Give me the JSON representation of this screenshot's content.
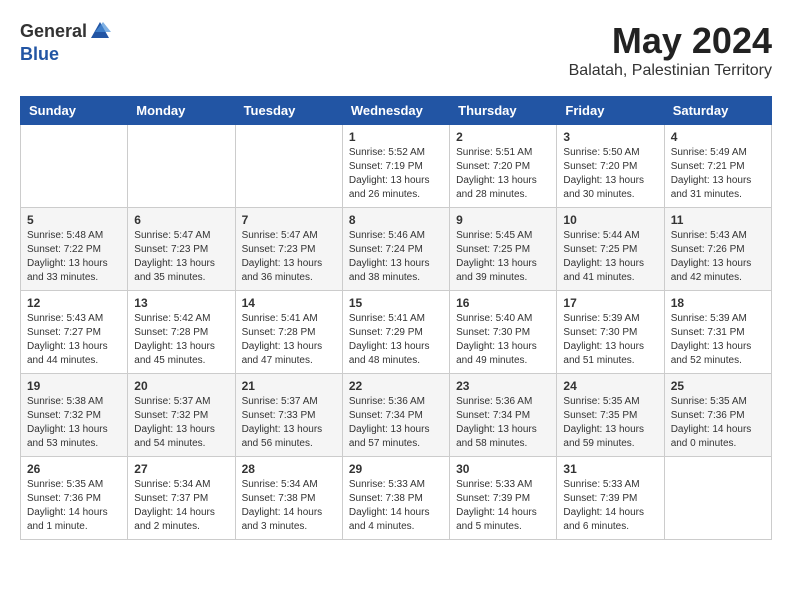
{
  "header": {
    "logo_general": "General",
    "logo_blue": "Blue",
    "month_title": "May 2024",
    "location": "Balatah, Palestinian Territory"
  },
  "weekdays": [
    "Sunday",
    "Monday",
    "Tuesday",
    "Wednesday",
    "Thursday",
    "Friday",
    "Saturday"
  ],
  "weeks": [
    [
      {
        "day": "",
        "info": ""
      },
      {
        "day": "",
        "info": ""
      },
      {
        "day": "",
        "info": ""
      },
      {
        "day": "1",
        "info": "Sunrise: 5:52 AM\nSunset: 7:19 PM\nDaylight: 13 hours\nand 26 minutes."
      },
      {
        "day": "2",
        "info": "Sunrise: 5:51 AM\nSunset: 7:20 PM\nDaylight: 13 hours\nand 28 minutes."
      },
      {
        "day": "3",
        "info": "Sunrise: 5:50 AM\nSunset: 7:20 PM\nDaylight: 13 hours\nand 30 minutes."
      },
      {
        "day": "4",
        "info": "Sunrise: 5:49 AM\nSunset: 7:21 PM\nDaylight: 13 hours\nand 31 minutes."
      }
    ],
    [
      {
        "day": "5",
        "info": "Sunrise: 5:48 AM\nSunset: 7:22 PM\nDaylight: 13 hours\nand 33 minutes."
      },
      {
        "day": "6",
        "info": "Sunrise: 5:47 AM\nSunset: 7:23 PM\nDaylight: 13 hours\nand 35 minutes."
      },
      {
        "day": "7",
        "info": "Sunrise: 5:47 AM\nSunset: 7:23 PM\nDaylight: 13 hours\nand 36 minutes."
      },
      {
        "day": "8",
        "info": "Sunrise: 5:46 AM\nSunset: 7:24 PM\nDaylight: 13 hours\nand 38 minutes."
      },
      {
        "day": "9",
        "info": "Sunrise: 5:45 AM\nSunset: 7:25 PM\nDaylight: 13 hours\nand 39 minutes."
      },
      {
        "day": "10",
        "info": "Sunrise: 5:44 AM\nSunset: 7:25 PM\nDaylight: 13 hours\nand 41 minutes."
      },
      {
        "day": "11",
        "info": "Sunrise: 5:43 AM\nSunset: 7:26 PM\nDaylight: 13 hours\nand 42 minutes."
      }
    ],
    [
      {
        "day": "12",
        "info": "Sunrise: 5:43 AM\nSunset: 7:27 PM\nDaylight: 13 hours\nand 44 minutes."
      },
      {
        "day": "13",
        "info": "Sunrise: 5:42 AM\nSunset: 7:28 PM\nDaylight: 13 hours\nand 45 minutes."
      },
      {
        "day": "14",
        "info": "Sunrise: 5:41 AM\nSunset: 7:28 PM\nDaylight: 13 hours\nand 47 minutes."
      },
      {
        "day": "15",
        "info": "Sunrise: 5:41 AM\nSunset: 7:29 PM\nDaylight: 13 hours\nand 48 minutes."
      },
      {
        "day": "16",
        "info": "Sunrise: 5:40 AM\nSunset: 7:30 PM\nDaylight: 13 hours\nand 49 minutes."
      },
      {
        "day": "17",
        "info": "Sunrise: 5:39 AM\nSunset: 7:30 PM\nDaylight: 13 hours\nand 51 minutes."
      },
      {
        "day": "18",
        "info": "Sunrise: 5:39 AM\nSunset: 7:31 PM\nDaylight: 13 hours\nand 52 minutes."
      }
    ],
    [
      {
        "day": "19",
        "info": "Sunrise: 5:38 AM\nSunset: 7:32 PM\nDaylight: 13 hours\nand 53 minutes."
      },
      {
        "day": "20",
        "info": "Sunrise: 5:37 AM\nSunset: 7:32 PM\nDaylight: 13 hours\nand 54 minutes."
      },
      {
        "day": "21",
        "info": "Sunrise: 5:37 AM\nSunset: 7:33 PM\nDaylight: 13 hours\nand 56 minutes."
      },
      {
        "day": "22",
        "info": "Sunrise: 5:36 AM\nSunset: 7:34 PM\nDaylight: 13 hours\nand 57 minutes."
      },
      {
        "day": "23",
        "info": "Sunrise: 5:36 AM\nSunset: 7:34 PM\nDaylight: 13 hours\nand 58 minutes."
      },
      {
        "day": "24",
        "info": "Sunrise: 5:35 AM\nSunset: 7:35 PM\nDaylight: 13 hours\nand 59 minutes."
      },
      {
        "day": "25",
        "info": "Sunrise: 5:35 AM\nSunset: 7:36 PM\nDaylight: 14 hours\nand 0 minutes."
      }
    ],
    [
      {
        "day": "26",
        "info": "Sunrise: 5:35 AM\nSunset: 7:36 PM\nDaylight: 14 hours\nand 1 minute."
      },
      {
        "day": "27",
        "info": "Sunrise: 5:34 AM\nSunset: 7:37 PM\nDaylight: 14 hours\nand 2 minutes."
      },
      {
        "day": "28",
        "info": "Sunrise: 5:34 AM\nSunset: 7:38 PM\nDaylight: 14 hours\nand 3 minutes."
      },
      {
        "day": "29",
        "info": "Sunrise: 5:33 AM\nSunset: 7:38 PM\nDaylight: 14 hours\nand 4 minutes."
      },
      {
        "day": "30",
        "info": "Sunrise: 5:33 AM\nSunset: 7:39 PM\nDaylight: 14 hours\nand 5 minutes."
      },
      {
        "day": "31",
        "info": "Sunrise: 5:33 AM\nSunset: 7:39 PM\nDaylight: 14 hours\nand 6 minutes."
      },
      {
        "day": "",
        "info": ""
      }
    ]
  ]
}
